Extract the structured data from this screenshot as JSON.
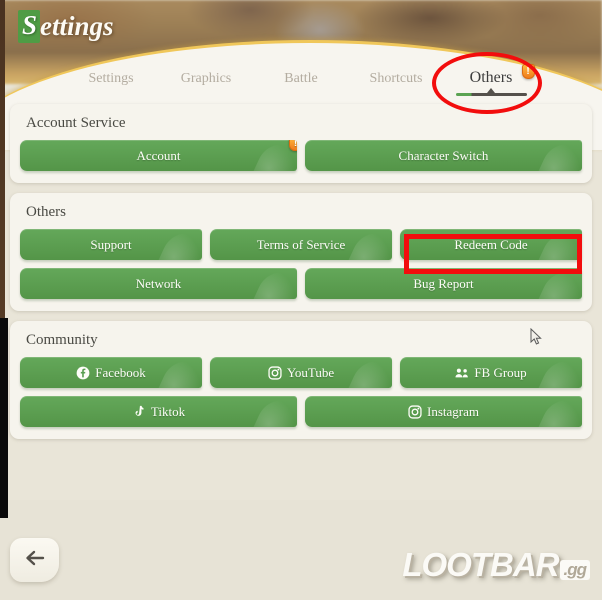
{
  "window": {
    "title_initial": "S",
    "title_rest": "ettings"
  },
  "tabs": {
    "items": [
      {
        "label": "Settings",
        "active": false
      },
      {
        "label": "Graphics",
        "active": false
      },
      {
        "label": "Battle",
        "active": false
      },
      {
        "label": "Shortcuts",
        "active": false
      },
      {
        "label": "Others",
        "active": true,
        "badge": "!"
      }
    ]
  },
  "sections": [
    {
      "title": "Account Service",
      "rows": [
        [
          {
            "label": "Account",
            "icon": "",
            "badge": "!"
          },
          {
            "label": "Character Switch",
            "icon": ""
          }
        ]
      ]
    },
    {
      "title": "Others",
      "rows": [
        [
          {
            "label": "Support",
            "icon": ""
          },
          {
            "label": "Terms of Service",
            "icon": ""
          },
          {
            "label": "Redeem Code",
            "icon": "",
            "highlighted": true
          }
        ],
        [
          {
            "label": "Network",
            "icon": ""
          },
          {
            "label": "Bug Report",
            "icon": ""
          }
        ]
      ]
    },
    {
      "title": "Community",
      "rows": [
        [
          {
            "label": "Facebook",
            "icon": "facebook-icon"
          },
          {
            "label": "YouTube",
            "icon": "camera-icon"
          },
          {
            "label": "FB Group",
            "icon": "users-group-icon"
          }
        ],
        [
          {
            "label": "Tiktok",
            "icon": "tiktok-icon"
          },
          {
            "label": "Instagram",
            "icon": "camera-icon"
          }
        ]
      ]
    }
  ],
  "footer": {
    "back_label": "back-arrow",
    "watermark_main": "LOOTBAR",
    "watermark_suffix": ".gg"
  },
  "annotations": {
    "tab_circle_color": "#f20d0d",
    "button_rect_color": "#f20d0d",
    "highlighted_button": "Redeem Code",
    "circled_tab": "Others"
  },
  "colors": {
    "button_green": "#5a9e52",
    "panel": "#f6f4ed",
    "page_bg": "#e9e5d8",
    "badge_orange": "#ef7c1c",
    "accent_gold": "#f0c75a"
  }
}
